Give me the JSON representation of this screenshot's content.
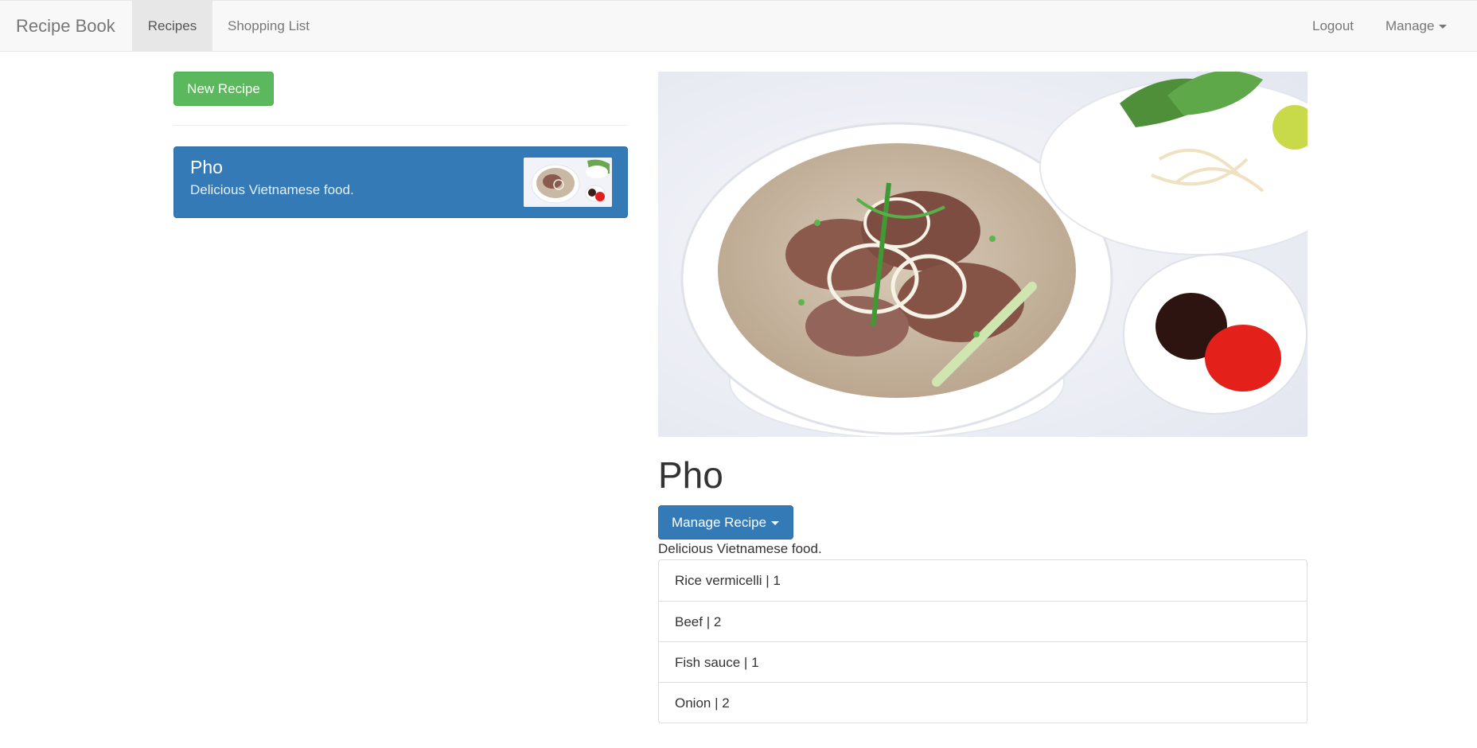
{
  "navbar": {
    "brand": "Recipe Book",
    "items": [
      {
        "label": "Recipes",
        "active": true
      },
      {
        "label": "Shopping List",
        "active": false
      }
    ],
    "right_items": [
      {
        "label": "Logout"
      },
      {
        "label": "Manage"
      }
    ]
  },
  "sidebar": {
    "new_button": "New Recipe",
    "recipes": [
      {
        "name": "Pho",
        "description": "Delicious Vietnamese food."
      }
    ]
  },
  "detail": {
    "title": "Pho",
    "manage_button": "Manage Recipe",
    "description": "Delicious Vietnamese food.",
    "ingredients": [
      {
        "text": "Rice vermicelli | 1"
      },
      {
        "text": "Beef | 2"
      },
      {
        "text": "Fish sauce | 1"
      },
      {
        "text": "Onion | 2"
      }
    ]
  },
  "colors": {
    "primary": "#337ab7",
    "success": "#5cb85c",
    "navbar_bg": "#f8f8f8"
  }
}
